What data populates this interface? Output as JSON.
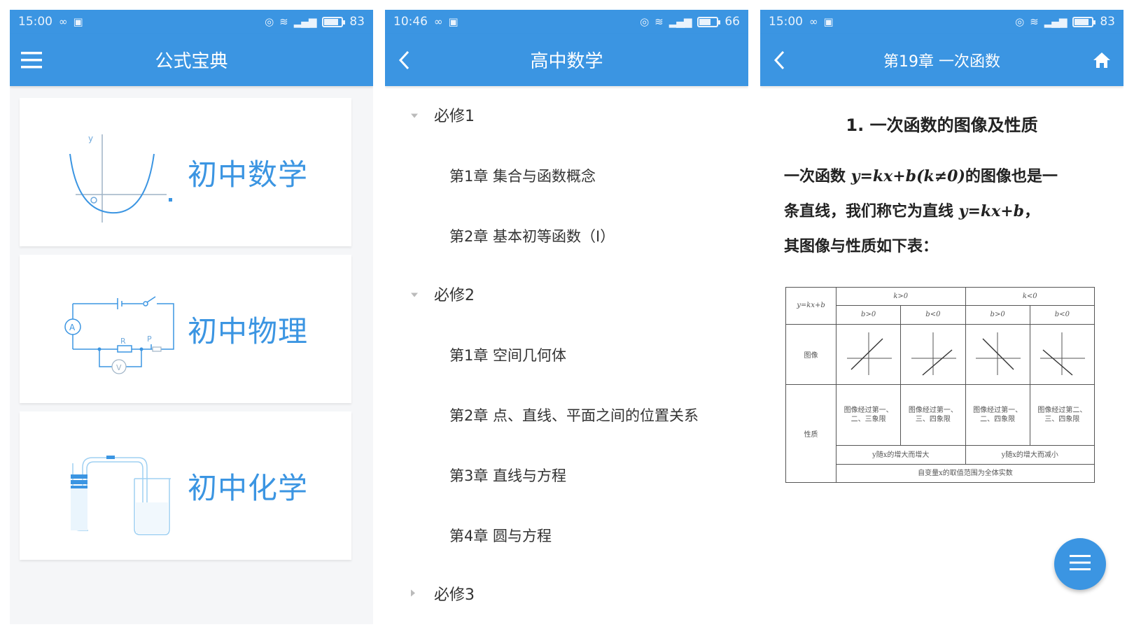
{
  "colors": {
    "primary": "#3b95e2",
    "text": "#333333"
  },
  "screen1": {
    "status": {
      "time": "15:00",
      "battery": "83",
      "battery_level": 0.83
    },
    "title": "公式宝典",
    "menu_icon": "hamburger-menu-icon",
    "cards": [
      {
        "label": "初中数学",
        "icon": "parabola-graph-illustration"
      },
      {
        "label": "初中物理",
        "icon": "circuit-diagram-illustration"
      },
      {
        "label": "初中化学",
        "icon": "test-tube-apparatus-illustration"
      }
    ]
  },
  "screen2": {
    "status": {
      "time": "10:46",
      "battery": "66",
      "battery_level": 0.66
    },
    "title": "高中数学",
    "back_icon": "back-chevron-icon",
    "groups": [
      {
        "label": "必修1",
        "expanded": true,
        "chapters": [
          "第1章 集合与函数概念",
          "第2章 基本初等函数（Ⅰ）"
        ]
      },
      {
        "label": "必修2",
        "expanded": true,
        "chapters": [
          "第1章 空间几何体",
          "第2章 点、直线、平面之间的位置关系",
          "第3章 直线与方程",
          "第4章 圆与方程"
        ]
      },
      {
        "label": "必修3",
        "expanded": false,
        "chapters": []
      }
    ]
  },
  "screen3": {
    "status": {
      "time": "15:00",
      "battery": "83",
      "battery_level": 0.83
    },
    "title": "第19章 一次函数",
    "back_icon": "back-chevron-icon",
    "home_icon": "home-icon",
    "section_title": "1. 一次函数的图像及性质",
    "paragraph": {
      "l1_a": "一次函数 ",
      "l1_formula": "y=kx+b(k≠0)",
      "l1_b": "的图像也是一",
      "l2_a": "条直线，我们称它为直线 ",
      "l2_formula": "y=kx+b",
      "l2_b": "，",
      "l3": "其图像与性质如下表："
    },
    "table": {
      "corner": "y=kx+b",
      "k_pos": "k>0",
      "k_neg": "k<0",
      "b_pos": "b>0",
      "b_neg": "b<0",
      "row_graph": "图像",
      "row_props": "性质",
      "props": [
        "图像经过第一、二、三象限",
        "图像经过第一、三、四象限",
        "图像经过第一、二、四象限",
        "图像经过第二、三、四象限"
      ],
      "k_pos_note": "y随x的增大而增大",
      "k_neg_note": "y随x的增大而减小",
      "bottom_note": "自变量x的取值范围为全体实数"
    },
    "fab_icon": "menu-fab-icon"
  }
}
